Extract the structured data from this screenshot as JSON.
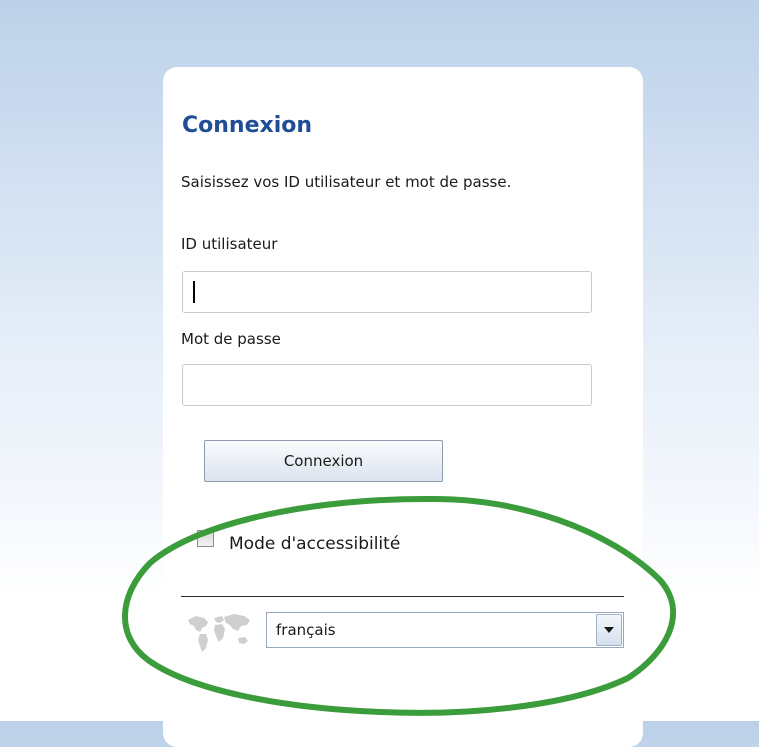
{
  "login": {
    "title": "Connexion",
    "instructions": "Saisissez vos ID utilisateur et mot de passe.",
    "user_id_label": "ID utilisateur",
    "user_id_value": "",
    "password_label": "Mot de passe",
    "password_value": "",
    "submit_label": "Connexion"
  },
  "accessibility": {
    "label": "Mode d'accessibilité",
    "checked": false
  },
  "language": {
    "icon": "world-map-icon",
    "selected": "français"
  },
  "annotation": {
    "color": "#3a9c3a"
  },
  "theme": {
    "title_color": "#1f4e96",
    "background_top": "#bcd1e8"
  }
}
